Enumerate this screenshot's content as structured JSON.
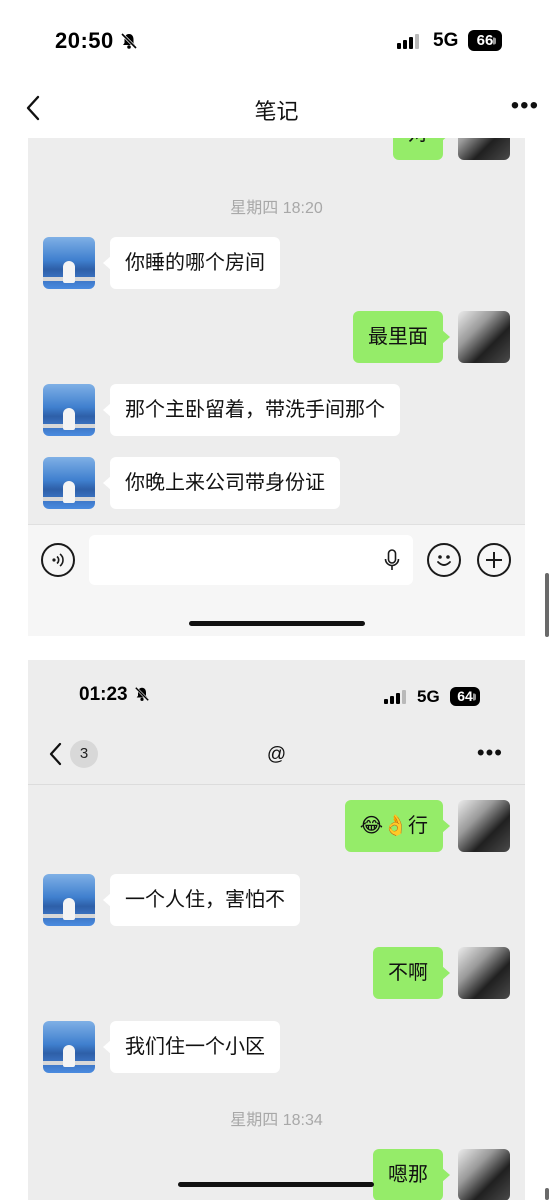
{
  "outer_status": {
    "time": "20:50",
    "network": "5G",
    "battery": "66"
  },
  "nav": {
    "title": "笔记"
  },
  "chat1": {
    "timestamp": "星期四 18:20",
    "partial_sent": "对",
    "messages": [
      {
        "side": "recv",
        "text": "你睡的哪个房间"
      },
      {
        "side": "sent",
        "text": "最里面"
      },
      {
        "side": "recv",
        "text": "那个主卧留着，带洗手间那个"
      },
      {
        "side": "recv",
        "text": "你晚上来公司带身份证"
      }
    ]
  },
  "input": {
    "value": "",
    "placeholder": ""
  },
  "inner_status": {
    "time": "01:23",
    "network": "5G",
    "battery": "64"
  },
  "nav2": {
    "unread": "3",
    "title": "@"
  },
  "chat2": {
    "messages": [
      {
        "side": "sent",
        "text": "😂👌行"
      },
      {
        "side": "recv",
        "text": "一个人住，害怕不"
      },
      {
        "side": "sent",
        "text": "不啊"
      },
      {
        "side": "recv",
        "text": "我们住一个小区"
      }
    ],
    "timestamp": "星期四 18:34",
    "last_sent": "嗯那"
  },
  "icons": [
    "bell-slash-icon",
    "signal-icon",
    "battery-icon",
    "back-chevron-icon",
    "more-icon",
    "voice-icon",
    "microphone-icon",
    "emoji-icon",
    "plus-icon"
  ]
}
